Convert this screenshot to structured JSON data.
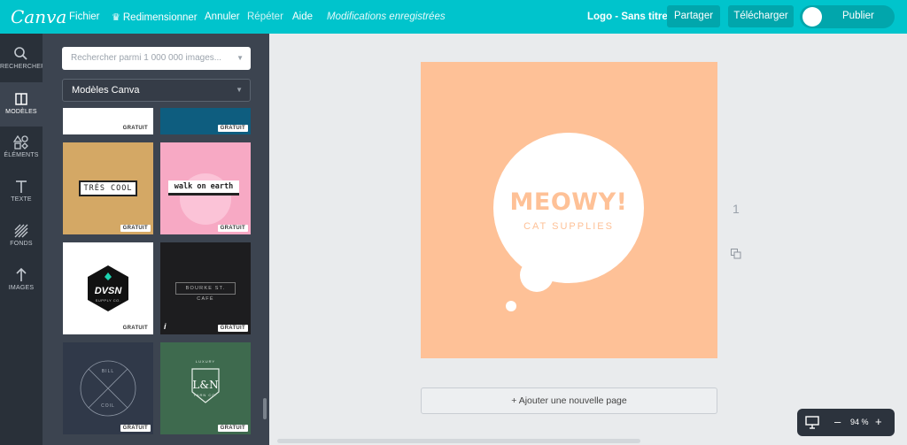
{
  "header": {
    "logo": "Canva",
    "menu": {
      "file": "Fichier",
      "resize": "Redimensionner",
      "undo": "Annuler",
      "redo": "Répéter",
      "help": "Aide",
      "saved": "Modifications enregistrées"
    },
    "doc_title": "Logo - Sans titre",
    "share": "Partager",
    "download": "Télécharger",
    "publish": "Publier"
  },
  "rail": {
    "items": [
      {
        "label": "RECHERCHER",
        "icon": "search-icon"
      },
      {
        "label": "MODÈLES",
        "icon": "templates-icon",
        "active": true
      },
      {
        "label": "ÉLÉMENTS",
        "icon": "shapes-icon"
      },
      {
        "label": "TEXTE",
        "icon": "text-icon"
      },
      {
        "label": "FONDS",
        "icon": "background-icon"
      },
      {
        "label": "IMAGES",
        "icon": "upload-icon"
      }
    ]
  },
  "panel": {
    "search_placeholder": "Rechercher parmi 1 000 000 images...",
    "category": "Modèles Canva",
    "badge": "GRATUIT",
    "templates": {
      "tres_cool": "TRÉS COOL",
      "walk": "walk on earth",
      "dvsn": "DVSN",
      "dvsn_sub": "SUPPLY CO.",
      "bourke": "BOURKE ST. CAFÉ",
      "bill": "BILL",
      "coil": "COIL",
      "l_n": "L&N",
      "l_n_top": "LUXURY",
      "l_n_bottom": "YARN CO."
    }
  },
  "canvas": {
    "headline": "MEOWY!",
    "subline": "CAT SUPPLIES",
    "page_number": "1",
    "add_page": "+ Ajouter une nouvelle page",
    "bg_color": "#fec197"
  },
  "zoom": {
    "minus": "–",
    "value": "94 %",
    "plus": "+"
  }
}
